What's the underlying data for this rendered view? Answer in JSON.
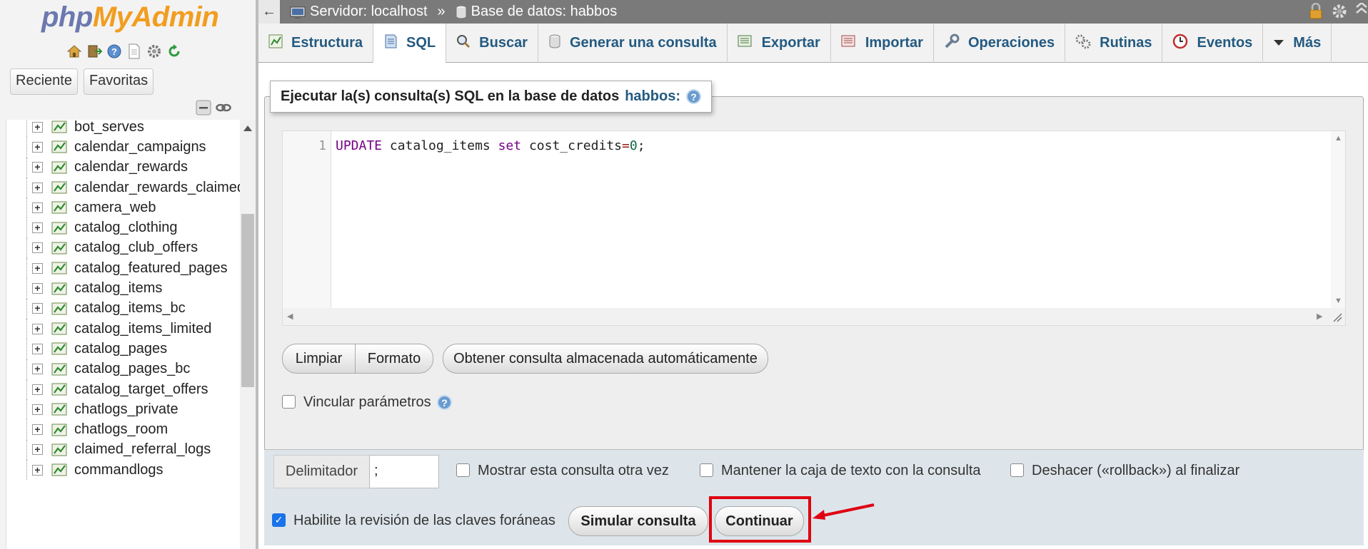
{
  "nav": {
    "logo_php": "php",
    "logo_myadmin": "MyAdmin",
    "icons": [
      "home-icon",
      "exit-icon",
      "help-icon",
      "docs-icon",
      "settings-icon",
      "reload-icon"
    ],
    "tabs": [
      "Reciente",
      "Favoritas"
    ],
    "tables": [
      "bot_serves",
      "calendar_campaigns",
      "calendar_rewards",
      "calendar_rewards_claimed",
      "camera_web",
      "catalog_clothing",
      "catalog_club_offers",
      "catalog_featured_pages",
      "catalog_items",
      "catalog_items_bc",
      "catalog_items_limited",
      "catalog_pages",
      "catalog_pages_bc",
      "catalog_target_offers",
      "chatlogs_private",
      "chatlogs_room",
      "claimed_referral_logs",
      "commandlogs"
    ]
  },
  "breadcrumb": {
    "server": "Servidor: localhost",
    "separator": "»",
    "database": "Base de datos: habbos"
  },
  "tabs": [
    {
      "label": "Estructura",
      "icon": "structure-icon"
    },
    {
      "label": "SQL",
      "icon": "sql-icon",
      "active": true
    },
    {
      "label": "Buscar",
      "icon": "search-icon"
    },
    {
      "label": "Generar una consulta",
      "icon": "query-icon"
    },
    {
      "label": "Exportar",
      "icon": "export-icon"
    },
    {
      "label": "Importar",
      "icon": "import-icon"
    },
    {
      "label": "Operaciones",
      "icon": "wrench-icon"
    },
    {
      "label": "Rutinas",
      "icon": "routines-icon"
    },
    {
      "label": "Eventos",
      "icon": "events-icon"
    },
    {
      "label": "Más",
      "icon": "chevron-down-icon"
    }
  ],
  "sql_panel": {
    "legend_text": "Ejecutar la(s) consulta(s) SQL en la base de datos",
    "legend_db": "habbos:",
    "line_number": "1",
    "query": {
      "kw1": "UPDATE",
      "table": " catalog_items ",
      "kw2": "set",
      "col": " cost_credits",
      "op": "=",
      "val": "0",
      "end": ";"
    },
    "buttons": {
      "clear": "Limpiar",
      "format": "Formato",
      "get_stored": "Obtener consulta almacenada automáticamente"
    },
    "bind_params": "Vincular parámetros"
  },
  "options": {
    "delimiter_label": "Delimitador",
    "delimiter_value": ";",
    "show_query_again": "Mostrar esta consulta otra vez",
    "keep_textarea": "Mantener la caja de texto con la consulta",
    "rollback": "Deshacer («rollback») al finalizar",
    "fk_checks": "Habilite la revisión de las claves foráneas",
    "fk_checks_checked": true,
    "simulate": "Simular consulta",
    "continue": "Continuar"
  },
  "colors": {
    "link_blue": "#235a81",
    "highlight_red": "#e00010",
    "logo_php": "#6c78af",
    "logo_myadmin": "#f29d1f"
  }
}
